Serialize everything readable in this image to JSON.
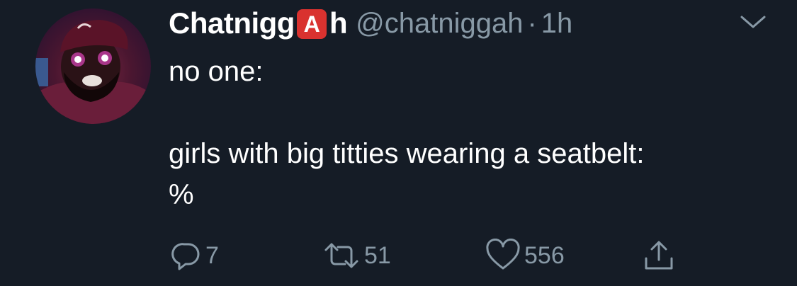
{
  "tweet": {
    "display_name_pre": "Chatnigg",
    "display_name_emoji": "A",
    "display_name_post": "h",
    "handle": "@chatniggah",
    "separator": "·",
    "time": "1h",
    "lines": [
      "no one:",
      "girls with big titties wearing a seatbelt:",
      "%"
    ]
  },
  "actions": {
    "reply_count": "7",
    "retweet_count": "51",
    "like_count": "556"
  },
  "colors": {
    "background": "#151c26",
    "text": "#ffffff",
    "secondary": "#8899a6",
    "emoji_red": "#d9322f"
  },
  "icons": [
    "reply-icon",
    "retweet-icon",
    "like-icon",
    "share-icon",
    "chevron-down-icon"
  ]
}
